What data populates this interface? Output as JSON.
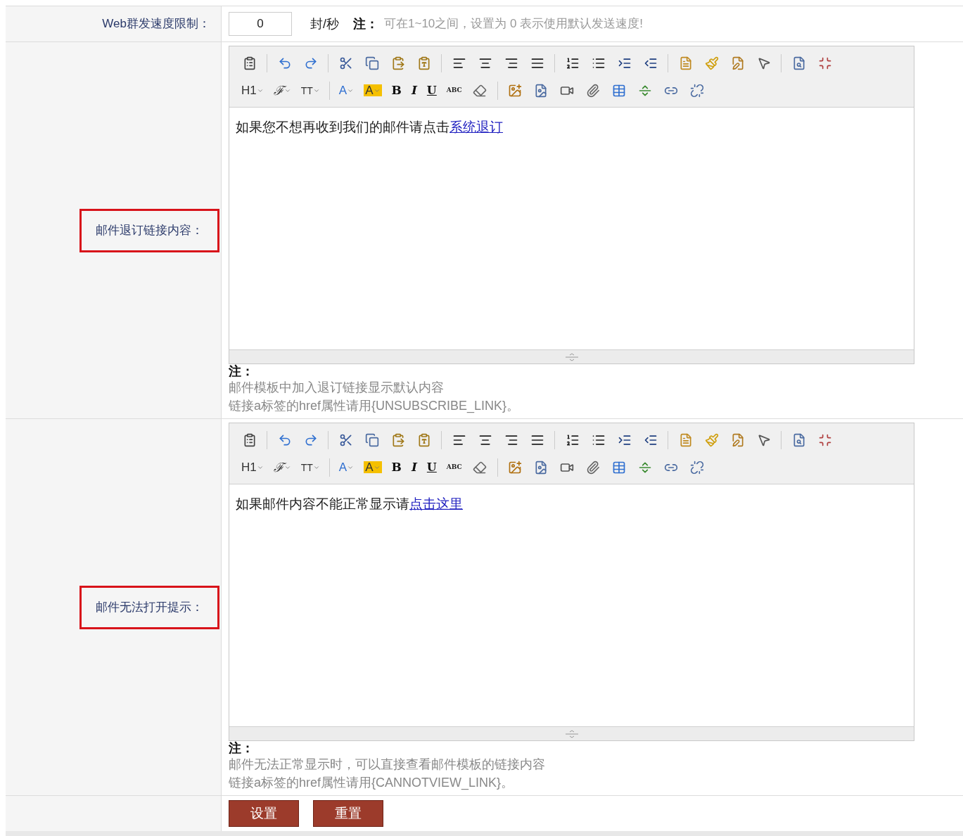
{
  "speed_row": {
    "label": "Web群发速度限制：",
    "input": {
      "value": "0"
    },
    "unit": "封/秒",
    "note_label": "注：",
    "note_text": "可在1~10之间，设置为 0 表示使用默认发送速度!"
  },
  "editor_rows": [
    {
      "label": "邮件退订链接内容：",
      "highlighted": true,
      "toolbar": [
        [
          {
            "kind": "clipboard"
          },
          {
            "kind": "sep"
          },
          {
            "kind": "undo"
          },
          {
            "kind": "redo"
          },
          {
            "kind": "sep"
          },
          {
            "kind": "cut"
          },
          {
            "kind": "copy"
          },
          {
            "kind": "paste"
          },
          {
            "kind": "pastetext"
          },
          {
            "kind": "sep"
          },
          {
            "kind": "alignleft"
          },
          {
            "kind": "aligncenter"
          },
          {
            "kind": "alignright"
          },
          {
            "kind": "justify"
          },
          {
            "kind": "sep"
          },
          {
            "kind": "ol"
          },
          {
            "kind": "ul"
          },
          {
            "kind": "indent"
          },
          {
            "kind": "outdent"
          },
          {
            "kind": "sep"
          },
          {
            "kind": "template"
          },
          {
            "kind": "brush"
          },
          {
            "kind": "edit"
          },
          {
            "kind": "pointer"
          },
          {
            "kind": "sep"
          },
          {
            "kind": "preview"
          },
          {
            "kind": "fullscreen"
          }
        ],
        [
          {
            "kind": "heading",
            "label": "H1"
          },
          {
            "kind": "font",
            "label": "ℱ"
          },
          {
            "kind": "size",
            "label": "TT"
          },
          {
            "kind": "sep"
          },
          {
            "kind": "color",
            "label": "A"
          },
          {
            "kind": "highlight",
            "label": "A"
          },
          {
            "kind": "bold",
            "label": "B"
          },
          {
            "kind": "italic",
            "label": "I"
          },
          {
            "kind": "underline",
            "label": "U"
          },
          {
            "kind": "strike",
            "label": "ABC"
          },
          {
            "kind": "eraser"
          },
          {
            "kind": "sep"
          },
          {
            "kind": "image"
          },
          {
            "kind": "flash"
          },
          {
            "kind": "video"
          },
          {
            "kind": "attach"
          },
          {
            "kind": "table"
          },
          {
            "kind": "hr"
          },
          {
            "kind": "link"
          },
          {
            "kind": "unlink"
          }
        ]
      ],
      "content": {
        "text": "如果您不想再收到我们的邮件请点击",
        "link": "系统退订"
      },
      "note_label": "注：",
      "notes": [
        "邮件模板中加入退订链接显示默认内容",
        "链接a标签的href属性请用{UNSUBSCRIBE_LINK}。"
      ]
    },
    {
      "label": "邮件无法打开提示：",
      "highlighted": true,
      "toolbar": [
        [
          {
            "kind": "clipboard"
          },
          {
            "kind": "sep"
          },
          {
            "kind": "undo"
          },
          {
            "kind": "redo"
          },
          {
            "kind": "sep"
          },
          {
            "kind": "cut"
          },
          {
            "kind": "copy"
          },
          {
            "kind": "paste"
          },
          {
            "kind": "pastetext"
          },
          {
            "kind": "sep"
          },
          {
            "kind": "alignleft"
          },
          {
            "kind": "aligncenter"
          },
          {
            "kind": "alignright"
          },
          {
            "kind": "justify"
          },
          {
            "kind": "sep"
          },
          {
            "kind": "ol"
          },
          {
            "kind": "ul"
          },
          {
            "kind": "indent"
          },
          {
            "kind": "outdent"
          },
          {
            "kind": "sep"
          },
          {
            "kind": "template"
          },
          {
            "kind": "brush"
          },
          {
            "kind": "edit"
          },
          {
            "kind": "pointer"
          },
          {
            "kind": "sep"
          },
          {
            "kind": "preview"
          },
          {
            "kind": "fullscreen"
          }
        ],
        [
          {
            "kind": "heading",
            "label": "H1"
          },
          {
            "kind": "font",
            "label": "ℱ"
          },
          {
            "kind": "size",
            "label": "TT"
          },
          {
            "kind": "sep"
          },
          {
            "kind": "color",
            "label": "A"
          },
          {
            "kind": "highlight",
            "label": "A"
          },
          {
            "kind": "bold",
            "label": "B"
          },
          {
            "kind": "italic",
            "label": "I"
          },
          {
            "kind": "underline",
            "label": "U"
          },
          {
            "kind": "strike",
            "label": "ABC"
          },
          {
            "kind": "eraser"
          },
          {
            "kind": "sep"
          },
          {
            "kind": "image"
          },
          {
            "kind": "flash"
          },
          {
            "kind": "video"
          },
          {
            "kind": "attach"
          },
          {
            "kind": "table"
          },
          {
            "kind": "hr"
          },
          {
            "kind": "link"
          },
          {
            "kind": "unlink"
          }
        ]
      ],
      "content": {
        "text": "如果邮件内容不能正常显示请",
        "link": "点击这里"
      },
      "note_label": "注：",
      "notes": [
        "邮件无法正常显示时，可以直接查看邮件模板的链接内容",
        "链接a标签的href属性请用{CANNOTVIEW_LINK}。"
      ]
    }
  ],
  "buttons": [
    "设置",
    "重置"
  ]
}
